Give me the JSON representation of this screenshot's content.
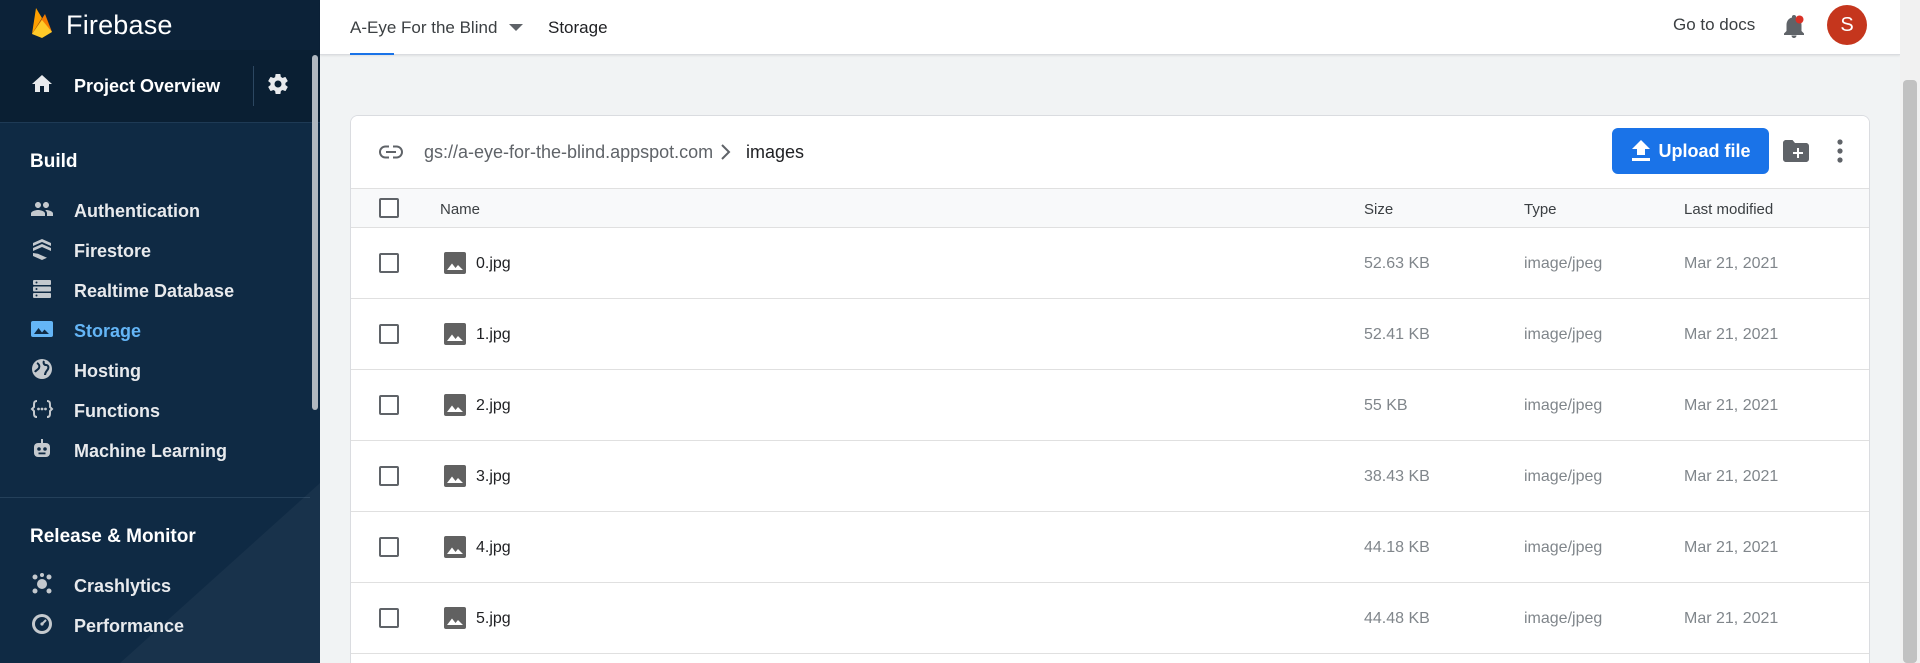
{
  "app": {
    "brand": "Firebase"
  },
  "sidebar": {
    "project_overview": "Project Overview",
    "build_title": "Build",
    "build_items": [
      {
        "label": "Authentication",
        "icon": "people-icon"
      },
      {
        "label": "Firestore",
        "icon": "firestore-icon"
      },
      {
        "label": "Realtime Database",
        "icon": "database-icon"
      },
      {
        "label": "Storage",
        "icon": "storage-image-icon",
        "active": true
      },
      {
        "label": "Hosting",
        "icon": "globe-icon"
      },
      {
        "label": "Functions",
        "icon": "functions-icon"
      },
      {
        "label": "Machine Learning",
        "icon": "robot-icon"
      }
    ],
    "release_title": "Release & Monitor",
    "release_items": [
      {
        "label": "Crashlytics",
        "icon": "crashlytics-icon"
      },
      {
        "label": "Performance",
        "icon": "speedometer-icon"
      }
    ]
  },
  "header": {
    "project_name": "A-Eye For the Blind",
    "breadcrumb": "Storage",
    "docs_link": "Go to docs",
    "avatar_initial": "S"
  },
  "storage": {
    "bucket_path": "gs://a-eye-for-the-blind.appspot.com",
    "current_folder": "images",
    "upload_label": "Upload file",
    "columns": {
      "name": "Name",
      "size": "Size",
      "type": "Type",
      "modified": "Last modified"
    },
    "files": [
      {
        "name": "0.jpg",
        "size": "52.63 KB",
        "type": "image/jpeg",
        "modified": "Mar 21, 2021"
      },
      {
        "name": "1.jpg",
        "size": "52.41 KB",
        "type": "image/jpeg",
        "modified": "Mar 21, 2021"
      },
      {
        "name": "2.jpg",
        "size": "55 KB",
        "type": "image/jpeg",
        "modified": "Mar 21, 2021"
      },
      {
        "name": "3.jpg",
        "size": "38.43 KB",
        "type": "image/jpeg",
        "modified": "Mar 21, 2021"
      },
      {
        "name": "4.jpg",
        "size": "44.18 KB",
        "type": "image/jpeg",
        "modified": "Mar 21, 2021"
      },
      {
        "name": "5.jpg",
        "size": "44.48 KB",
        "type": "image/jpeg",
        "modified": "Mar 21, 2021"
      }
    ]
  },
  "colors": {
    "sidebar_bg": "#0f2a44",
    "accent": "#1a73e8",
    "active_nav": "#64b5f6",
    "avatar": "#c5361d"
  }
}
